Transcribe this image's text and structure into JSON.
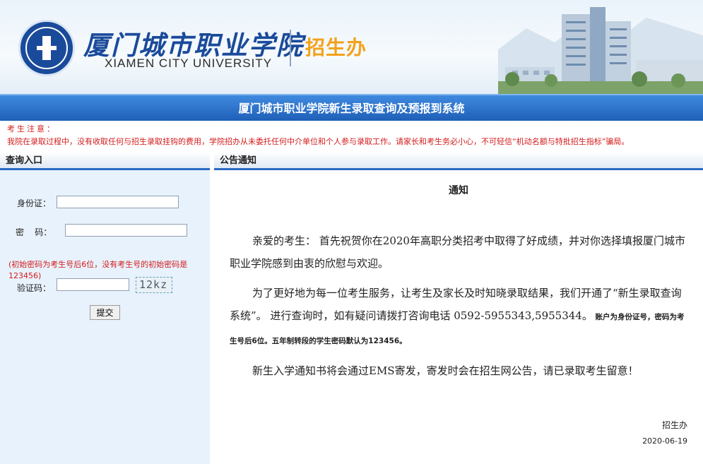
{
  "header": {
    "school_cn": "厦门城市职业学院",
    "school_en": "XIAMEN CITY UNIVERSITY",
    "office": "招生办"
  },
  "title_bar": "厦门城市职业学院新生录取查询及预报到系统",
  "notice": {
    "title": "考生注意：",
    "text": "我院在录取过程中，没有收取任何与招生录取挂钩的费用，学院招办从未委托任何中介单位和个人参与录取工作。请家长和考生务必小心，不可轻信“机动名额与特批招生指标”骗局。"
  },
  "login": {
    "heading": "查询入口",
    "id_label": "身份证：",
    "id_value": "",
    "password_label": "密    码：",
    "password_value": "",
    "password_hint": "(初始密码为考生号后6位，没有考生号的初始密码是123456)",
    "captcha_label": "验证码：",
    "captcha_value": "",
    "captcha_image_text": "12kz",
    "submit_label": "提交"
  },
  "announcement": {
    "heading": "公告通知",
    "title": "通知",
    "p1": "亲爱的考生：  首先祝贺你在2020年高职分类招考中取得了好成绩，并对你选择填报厦门城市职业学院感到由衷的欣慰与欢迎。",
    "p2_main": "为了更好地为每一位考生服务，让考生及家长及时知晓录取结果，我们开通了“新生录取查询系统”。 进行查询时，如有疑问请拨打咨询电话 0592-5955343,5955344。",
    "p2_bold": " 账户为身份证号，密码为考生号后6位。五年制转段的学生密码默认为123456。",
    "p3": "新生入学通知书将会通过EMS寄发，寄发时会在招生网公告，请已录取考生留意！",
    "signature": "招生办",
    "date": "2020-06-19"
  },
  "colors": {
    "brand_blue": "#1a4a9a",
    "title_bar": "#2b69c4",
    "accent_orange": "#f3a21c",
    "warning_red": "#d31b1b",
    "left_panel_bg": "#e8f2fc"
  }
}
